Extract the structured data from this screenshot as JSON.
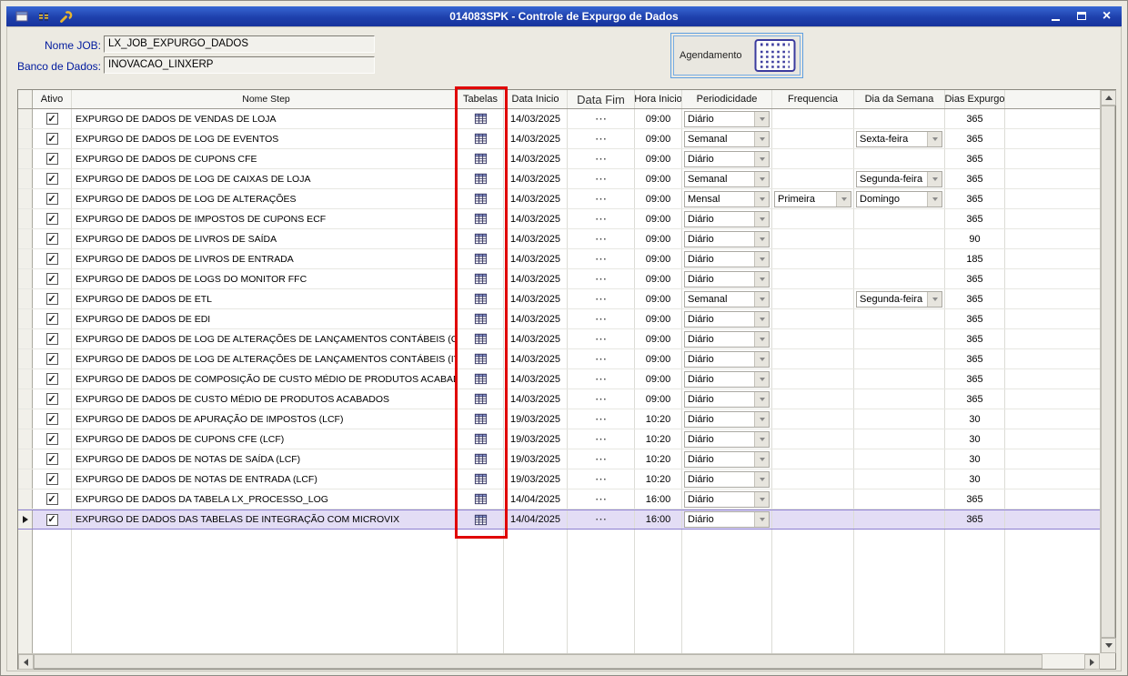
{
  "titlebar": {
    "title": "014083SPK - Controle de Expurgo de Dados",
    "left_icons": [
      "form-window-icon",
      "data-columns-icon",
      "wrench-icon"
    ],
    "window_controls": [
      "minimize",
      "maximize",
      "close"
    ]
  },
  "form": {
    "nome_job_label": "Nome JOB:",
    "nome_job_value": "LX_JOB_EXPURGO_DADOS",
    "banco_de_dados_label": "Banco de Dados:",
    "banco_de_dados_value": "INOVACAO_LINXERP",
    "agendamento_label": "Agendamento"
  },
  "icons": {
    "tables_icon": "table-grid",
    "calendar_icon": "calendar",
    "combo_arrow": "chevron-down",
    "current_row_indicator": "arrow-right"
  },
  "grid": {
    "columns": [
      "Ativo",
      "Nome Step",
      "Tabelas",
      "Data Inicio",
      "Data Fim",
      "Hora Inicio",
      "Periodicidade",
      "Frequencia",
      "Dia da Semana",
      "Dias Expurgo"
    ],
    "rows": [
      {
        "ativo": true,
        "nome_step": "EXPURGO DE DADOS DE VENDAS DE LOJA",
        "data_inicio": "14/03/2025",
        "data_fim": "⋯",
        "hora_inicio": "09:00",
        "periodicidade": "Diário",
        "frequencia": "",
        "dia_da_semana": "",
        "dias_expurgo": "365",
        "selected": false
      },
      {
        "ativo": true,
        "nome_step": "EXPURGO DE DADOS DE LOG DE EVENTOS",
        "data_inicio": "14/03/2025",
        "data_fim": "⋯",
        "hora_inicio": "09:00",
        "periodicidade": "Semanal",
        "frequencia": "",
        "dia_da_semana": "Sexta-feira",
        "dias_expurgo": "365",
        "selected": false
      },
      {
        "ativo": true,
        "nome_step": "EXPURGO DE DADOS DE CUPONS CFE",
        "data_inicio": "14/03/2025",
        "data_fim": "⋯",
        "hora_inicio": "09:00",
        "periodicidade": "Diário",
        "frequencia": "",
        "dia_da_semana": "",
        "dias_expurgo": "365",
        "selected": false
      },
      {
        "ativo": true,
        "nome_step": "EXPURGO DE DADOS DE LOG DE CAIXAS DE LOJA",
        "data_inicio": "14/03/2025",
        "data_fim": "⋯",
        "hora_inicio": "09:00",
        "periodicidade": "Semanal",
        "frequencia": "",
        "dia_da_semana": "Segunda-feira",
        "dias_expurgo": "365",
        "selected": false
      },
      {
        "ativo": true,
        "nome_step": "EXPURGO DE DADOS DE LOG DE ALTERAÇÕES",
        "data_inicio": "14/03/2025",
        "data_fim": "⋯",
        "hora_inicio": "09:00",
        "periodicidade": "Mensal",
        "frequencia": "Primeira",
        "dia_da_semana": "Domingo",
        "dias_expurgo": "365",
        "selected": false
      },
      {
        "ativo": true,
        "nome_step": "EXPURGO DE DADOS DE IMPOSTOS DE CUPONS ECF",
        "data_inicio": "14/03/2025",
        "data_fim": "⋯",
        "hora_inicio": "09:00",
        "periodicidade": "Diário",
        "frequencia": "",
        "dia_da_semana": "",
        "dias_expurgo": "365",
        "selected": false
      },
      {
        "ativo": true,
        "nome_step": "EXPURGO DE DADOS DE LIVROS DE SAÍDA",
        "data_inicio": "14/03/2025",
        "data_fim": "⋯",
        "hora_inicio": "09:00",
        "periodicidade": "Diário",
        "frequencia": "",
        "dia_da_semana": "",
        "dias_expurgo": "90",
        "selected": false
      },
      {
        "ativo": true,
        "nome_step": "EXPURGO DE DADOS DE LIVROS DE ENTRADA",
        "data_inicio": "14/03/2025",
        "data_fim": "⋯",
        "hora_inicio": "09:00",
        "periodicidade": "Diário",
        "frequencia": "",
        "dia_da_semana": "",
        "dias_expurgo": "185",
        "selected": false
      },
      {
        "ativo": true,
        "nome_step": "EXPURGO DE DADOS DE LOGS DO MONITOR FFC",
        "data_inicio": "14/03/2025",
        "data_fim": "⋯",
        "hora_inicio": "09:00",
        "periodicidade": "Diário",
        "frequencia": "",
        "dia_da_semana": "",
        "dias_expurgo": "365",
        "selected": false
      },
      {
        "ativo": true,
        "nome_step": "EXPURGO DE DADOS DE ETL",
        "data_inicio": "14/03/2025",
        "data_fim": "⋯",
        "hora_inicio": "09:00",
        "periodicidade": "Semanal",
        "frequencia": "",
        "dia_da_semana": "Segunda-feira",
        "dias_expurgo": "365",
        "selected": false
      },
      {
        "ativo": true,
        "nome_step": "EXPURGO DE DADOS DE EDI",
        "data_inicio": "14/03/2025",
        "data_fim": "⋯",
        "hora_inicio": "09:00",
        "periodicidade": "Diário",
        "frequencia": "",
        "dia_da_semana": "",
        "dias_expurgo": "365",
        "selected": false
      },
      {
        "ativo": true,
        "nome_step": "EXPURGO DE DADOS DE LOG DE ALTERAÇÕES DE LANÇAMENTOS CONTÁBEIS (CAPAS)",
        "data_inicio": "14/03/2025",
        "data_fim": "⋯",
        "hora_inicio": "09:00",
        "periodicidade": "Diário",
        "frequencia": "",
        "dia_da_semana": "",
        "dias_expurgo": "365",
        "selected": false
      },
      {
        "ativo": true,
        "nome_step": "EXPURGO DE DADOS DE LOG DE ALTERAÇÕES DE LANÇAMENTOS CONTÁBEIS (ITENS)",
        "data_inicio": "14/03/2025",
        "data_fim": "⋯",
        "hora_inicio": "09:00",
        "periodicidade": "Diário",
        "frequencia": "",
        "dia_da_semana": "",
        "dias_expurgo": "365",
        "selected": false
      },
      {
        "ativo": true,
        "nome_step": "EXPURGO DE DADOS DE COMPOSIÇÃO DE CUSTO MÉDIO DE PRODUTOS ACABADOS",
        "data_inicio": "14/03/2025",
        "data_fim": "⋯",
        "hora_inicio": "09:00",
        "periodicidade": "Diário",
        "frequencia": "",
        "dia_da_semana": "",
        "dias_expurgo": "365",
        "selected": false
      },
      {
        "ativo": true,
        "nome_step": "EXPURGO DE DADOS DE CUSTO MÉDIO DE PRODUTOS ACABADOS",
        "data_inicio": "14/03/2025",
        "data_fim": "⋯",
        "hora_inicio": "09:00",
        "periodicidade": "Diário",
        "frequencia": "",
        "dia_da_semana": "",
        "dias_expurgo": "365",
        "selected": false
      },
      {
        "ativo": true,
        "nome_step": "EXPURGO DE DADOS DE APURAÇÃO DE IMPOSTOS (LCF)",
        "data_inicio": "19/03/2025",
        "data_fim": "⋯",
        "hora_inicio": "10:20",
        "periodicidade": "Diário",
        "frequencia": "",
        "dia_da_semana": "",
        "dias_expurgo": "30",
        "selected": false
      },
      {
        "ativo": true,
        "nome_step": "EXPURGO DE DADOS DE CUPONS CFE (LCF)",
        "data_inicio": "19/03/2025",
        "data_fim": "⋯",
        "hora_inicio": "10:20",
        "periodicidade": "Diário",
        "frequencia": "",
        "dia_da_semana": "",
        "dias_expurgo": "30",
        "selected": false
      },
      {
        "ativo": true,
        "nome_step": "EXPURGO DE DADOS DE NOTAS DE SAÍDA (LCF)",
        "data_inicio": "19/03/2025",
        "data_fim": "⋯",
        "hora_inicio": "10:20",
        "periodicidade": "Diário",
        "frequencia": "",
        "dia_da_semana": "",
        "dias_expurgo": "30",
        "selected": false
      },
      {
        "ativo": true,
        "nome_step": "EXPURGO DE DADOS DE NOTAS DE ENTRADA (LCF)",
        "data_inicio": "19/03/2025",
        "data_fim": "⋯",
        "hora_inicio": "10:20",
        "periodicidade": "Diário",
        "frequencia": "",
        "dia_da_semana": "",
        "dias_expurgo": "30",
        "selected": false
      },
      {
        "ativo": true,
        "nome_step": "EXPURGO DE DADOS DA TABELA LX_PROCESSO_LOG",
        "data_inicio": "14/04/2025",
        "data_fim": "⋯",
        "hora_inicio": "16:00",
        "periodicidade": "Diário",
        "frequencia": "",
        "dia_da_semana": "",
        "dias_expurgo": "365",
        "selected": false
      },
      {
        "ativo": true,
        "nome_step": "EXPURGO DE DADOS DAS TABELAS DE INTEGRAÇÃO COM MICROVIX",
        "data_inicio": "14/04/2025",
        "data_fim": "⋯",
        "hora_inicio": "16:00",
        "periodicidade": "Diário",
        "frequencia": "",
        "dia_da_semana": "",
        "dias_expurgo": "365",
        "selected": true
      }
    ]
  },
  "annotation": {
    "highlighted_column": "Tabelas"
  },
  "colors": {
    "titlebar_blue": "#1E40AC",
    "selected_row": "#E3DDF5",
    "label_text": "#001A9E",
    "annotation_red": "#E00000"
  }
}
